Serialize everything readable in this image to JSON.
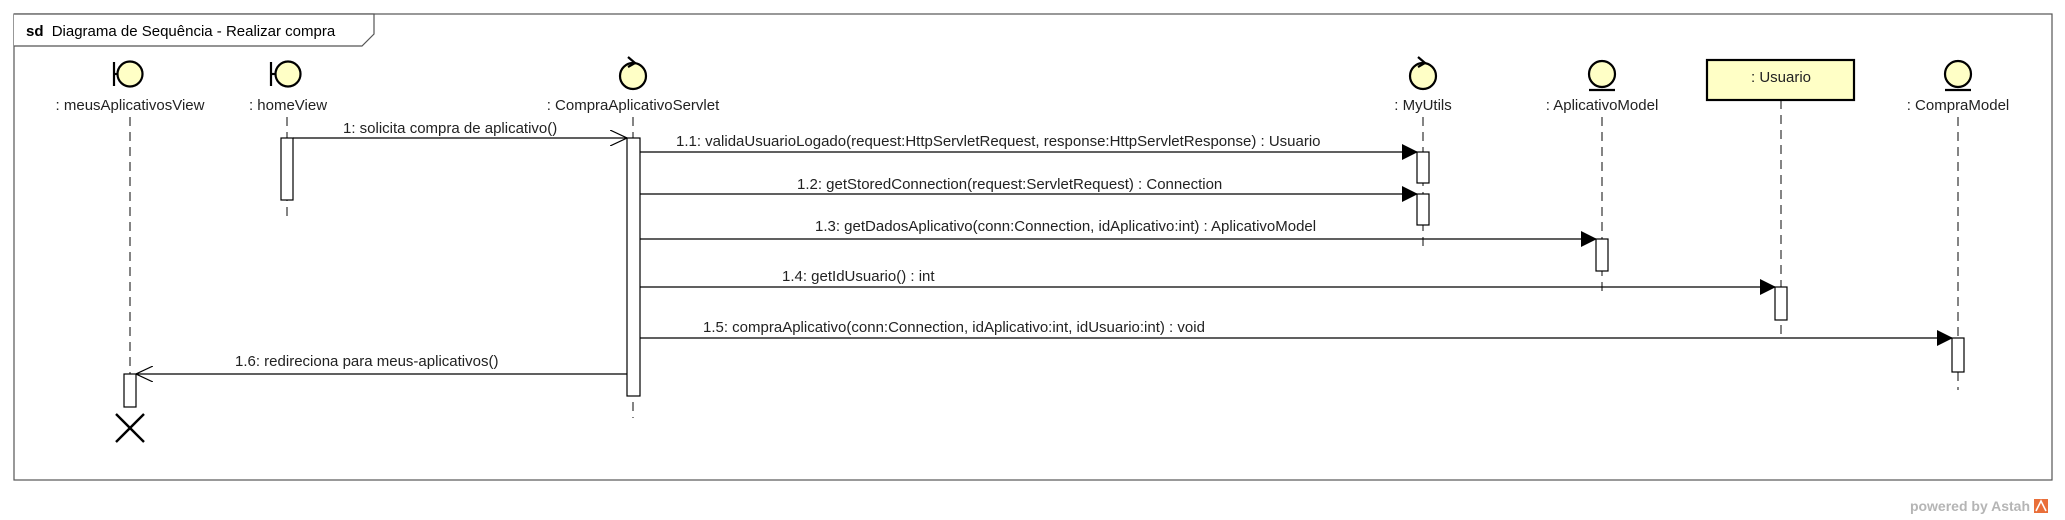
{
  "frame": {
    "keyword": "sd",
    "title": "Diagrama de Sequência - Realizar compra"
  },
  "lifelines": [
    {
      "id": "meusAplicativosView",
      "label": ": meusAplicativosView",
      "stereotype": "boundary"
    },
    {
      "id": "homeView",
      "label": ": homeView",
      "stereotype": "boundary"
    },
    {
      "id": "CompraAplicativoServlet",
      "label": ": CompraAplicativoServlet",
      "stereotype": "control"
    },
    {
      "id": "MyUtils",
      "label": ": MyUtils",
      "stereotype": "control"
    },
    {
      "id": "AplicativoModel",
      "label": ": AplicativoModel",
      "stereotype": "entity"
    },
    {
      "id": "Usuario",
      "label": ": Usuario",
      "stereotype": "class"
    },
    {
      "id": "CompraModel",
      "label": ": CompraModel",
      "stereotype": "entity"
    }
  ],
  "messages": [
    {
      "label": "1: solicita compra de aplicativo()",
      "from": "homeView",
      "to": "CompraAplicativoServlet",
      "kind": "async"
    },
    {
      "label": "1.1: validaUsuarioLogado(request:HttpServletRequest, response:HttpServletResponse) : Usuario",
      "from": "CompraAplicativoServlet",
      "to": "MyUtils",
      "kind": "sync"
    },
    {
      "label": "1.2: getStoredConnection(request:ServletRequest) : Connection",
      "from": "CompraAplicativoServlet",
      "to": "MyUtils",
      "kind": "sync"
    },
    {
      "label": "1.3: getDadosAplicativo(conn:Connection, idAplicativo:int) : AplicativoModel",
      "from": "CompraAplicativoServlet",
      "to": "AplicativoModel",
      "kind": "sync"
    },
    {
      "label": "1.4: getIdUsuario() : int",
      "from": "CompraAplicativoServlet",
      "to": "Usuario",
      "kind": "sync"
    },
    {
      "label": "1.5: compraAplicativo(conn:Connection, idAplicativo:int, idUsuario:int) : void",
      "from": "CompraAplicativoServlet",
      "to": "CompraModel",
      "kind": "sync"
    },
    {
      "label": "1.6: redireciona para meus-aplicativos()",
      "from": "CompraAplicativoServlet",
      "to": "meusAplicativosView",
      "kind": "async"
    }
  ],
  "destroyed": [
    "meusAplicativosView"
  ],
  "footer": {
    "text": "powered by Astah"
  },
  "colors": {
    "lifeline_fill": "#ffffc6",
    "line": "#000000",
    "brand": "#e96f3a"
  }
}
